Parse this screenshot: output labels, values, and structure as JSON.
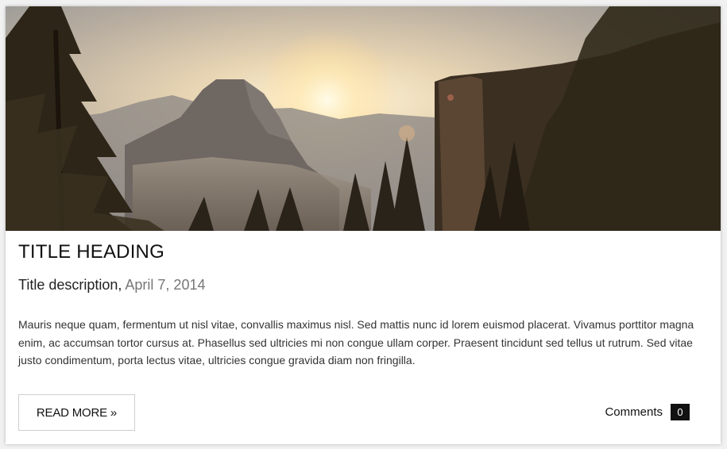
{
  "card": {
    "title": "TITLE HEADING",
    "description": "Title description,",
    "date": "April 7, 2014",
    "body": "Mauris neque quam, fermentum ut nisl vitae, convallis maximus nisl. Sed mattis nunc id lorem euismod placerat. Vivamus porttitor magna enim, ac accumsan tortor cursus at. Phasellus sed ultricies mi non congue ullam corper. Praesent tincidunt sed tellus ut rutrum. Sed vitae justo condimentum, porta lectus vitae, ultricies congue gravida diam non fringilla.",
    "read_more_label": "READ MORE »",
    "comments_label": "Comments",
    "comments_count": "0"
  },
  "colors": {
    "accent": "#111111",
    "date": "#777777",
    "card_bg": "#ffffff"
  }
}
